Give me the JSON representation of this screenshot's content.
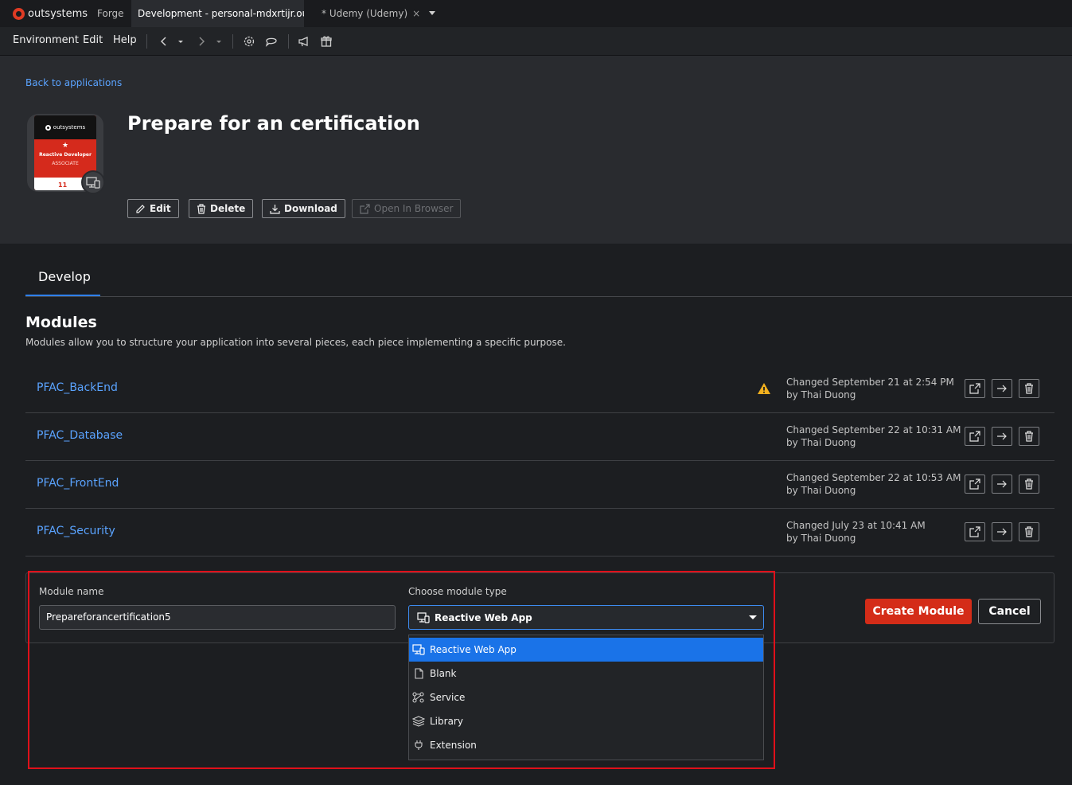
{
  "tabs": {
    "logo_text": "outsystems",
    "items": [
      {
        "label": "Forge"
      },
      {
        "label": "Development - personal-mdxrtijr.outsys"
      },
      {
        "label": "* Udemy (Udemy)",
        "close": "×"
      }
    ]
  },
  "menubar": {
    "items": [
      "Environment",
      "Edit",
      "Help"
    ]
  },
  "header": {
    "back_link": "Back to applications",
    "app_title": "Prepare for an certification",
    "badge": {
      "brand": "outsystems",
      "line1": "Reactive Developer",
      "line2": "ASSOCIATE",
      "version": "11"
    },
    "buttons": {
      "edit": "Edit",
      "delete": "Delete",
      "download": "Download",
      "open_in_browser": "Open In Browser"
    }
  },
  "develop": {
    "tab_label": "Develop",
    "modules_title": "Modules",
    "modules_description": "Modules allow you to structure your application into several pieces, each piece implementing a specific purpose.",
    "modules": [
      {
        "name": "PFAC_BackEnd",
        "changed": "Changed September 21 at 2:54 PM",
        "by": "by Thai Duong",
        "warning": true
      },
      {
        "name": "PFAC_Database",
        "changed": "Changed September 22 at 10:31 AM",
        "by": "by Thai Duong",
        "warning": false
      },
      {
        "name": "PFAC_FrontEnd",
        "changed": "Changed September 22 at 10:53 AM",
        "by": "by Thai Duong",
        "warning": false
      },
      {
        "name": "PFAC_Security",
        "changed": "Changed July 23 at 10:41 AM",
        "by": "by Thai Duong",
        "warning": false
      }
    ]
  },
  "create_module": {
    "name_label": "Module name",
    "name_value": "Prepareforancertification5",
    "type_label": "Choose module type",
    "type_value": "Reactive Web App",
    "create_label": "Create Module",
    "cancel_label": "Cancel",
    "options": [
      {
        "label": "Reactive Web App",
        "icon": "reactive-web-app-icon",
        "selected": true
      },
      {
        "label": "Blank",
        "icon": "blank-file-icon",
        "selected": false
      },
      {
        "label": "Service",
        "icon": "service-icon",
        "selected": false
      },
      {
        "label": "Library",
        "icon": "library-icon",
        "selected": false
      },
      {
        "label": "Extension",
        "icon": "extension-plug-icon",
        "selected": false
      }
    ]
  },
  "colors": {
    "accent_blue": "#2f80ed",
    "link_blue": "#5aa3ff",
    "create_red": "#d42c18",
    "highlight_red": "#e0101a",
    "warning_yellow": "#f2b01e"
  }
}
